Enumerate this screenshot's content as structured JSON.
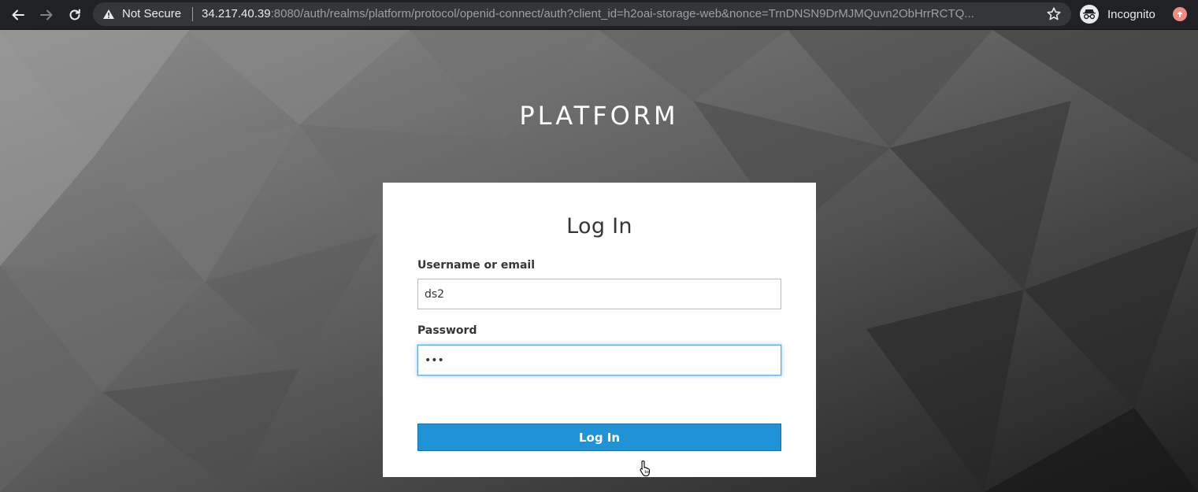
{
  "browser": {
    "security_label": "Not Secure",
    "url_host": "34.217.40.39",
    "url_rest": ":8080/auth/realms/platform/protocol/openid-connect/auth?client_id=h2oai-storage-web&nonce=TrnDNSN9DrMJMQuvn2ObHrrRCTQ...",
    "profile_label": "Incognito",
    "icons": [
      "back-icon",
      "forward-icon",
      "reload-icon",
      "warning-icon",
      "bookmark-star-icon",
      "incognito-icon",
      "update-icon"
    ]
  },
  "page": {
    "realm_title": "PLATFORM",
    "login": {
      "title": "Log In",
      "username_label": "Username or email",
      "username_value": "ds2",
      "password_label": "Password",
      "password_value": "•••",
      "submit_label": "Log In"
    }
  },
  "colors": {
    "button": "#2093d6",
    "focus_ring": "#66afe9",
    "card": "#ffffff",
    "chrome": "#202124"
  }
}
